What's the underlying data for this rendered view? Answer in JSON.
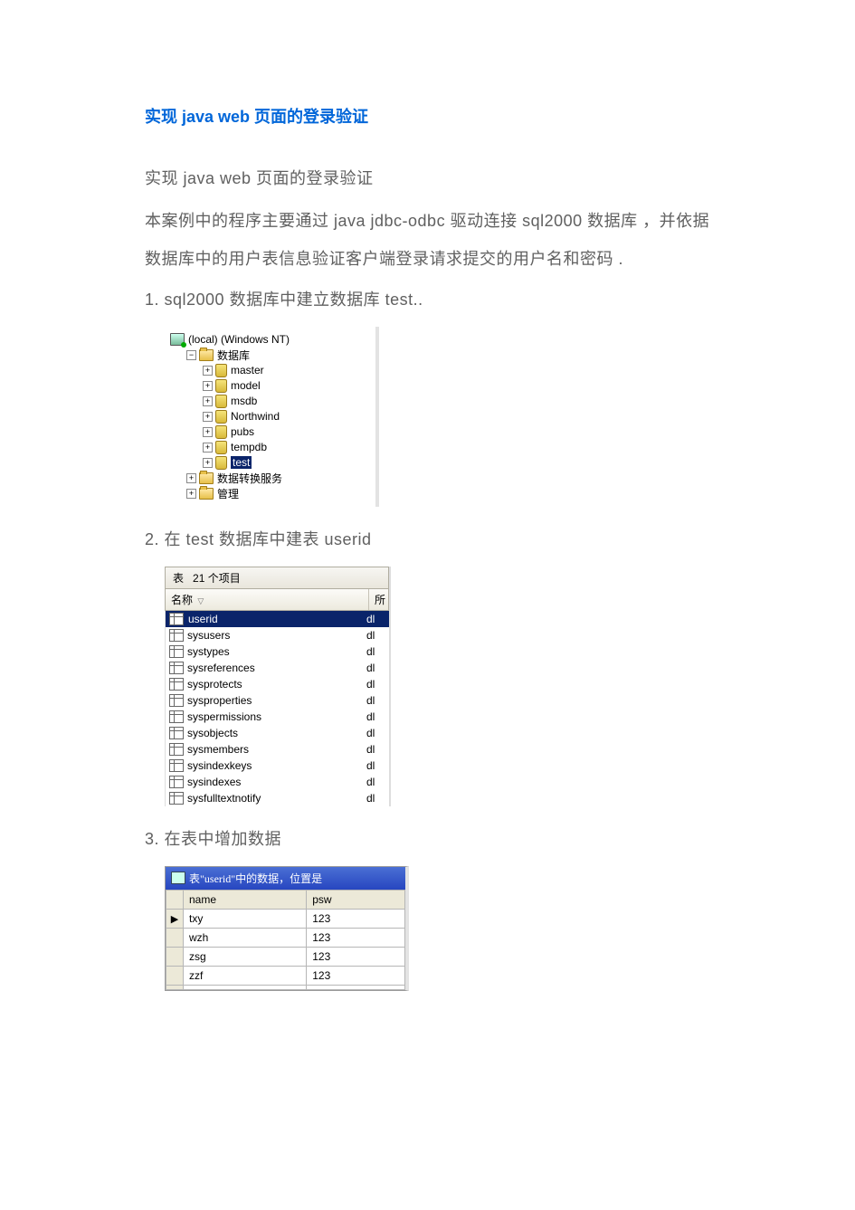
{
  "title": "实现 java web 页面的登录验证",
  "intro_1": "实现 java web 页面的登录验证",
  "intro_2": "本案例中的程序主要通过 java jdbc-odbc 驱动连接 sql2000 数据库 ，并依据数据库中的用户表信息验证客户端登录请求提交的用户名和密码 .",
  "step_1": "1. sql2000 数据库中建立数据库 test..",
  "step_2": "2. 在 test 数据库中建表 userid",
  "step_3": "3.  在表中增加数据",
  "tree": {
    "root": "(local) (Windows NT)",
    "folder_db": "数据库",
    "databases": [
      "master",
      "model",
      "msdb",
      "Northwind",
      "pubs",
      "tempdb"
    ],
    "selected_db": "test",
    "folder_dts": "数据转换服务",
    "folder_mgmt": "管理"
  },
  "tables": {
    "title_pre": "表",
    "title_count": "21 个项目",
    "col_name": "名称",
    "col_owner": "所",
    "rows": [
      {
        "name": "userid",
        "owner": "dl",
        "selected": true
      },
      {
        "name": "sysusers",
        "owner": "dl"
      },
      {
        "name": "systypes",
        "owner": "dl"
      },
      {
        "name": "sysreferences",
        "owner": "dl"
      },
      {
        "name": "sysprotects",
        "owner": "dl"
      },
      {
        "name": "sysproperties",
        "owner": "dl"
      },
      {
        "name": "syspermissions",
        "owner": "dl"
      },
      {
        "name": "sysobjects",
        "owner": "dl"
      },
      {
        "name": "sysmembers",
        "owner": "dl"
      },
      {
        "name": "sysindexkeys",
        "owner": "dl"
      },
      {
        "name": "sysindexes",
        "owner": "dl"
      },
      {
        "name": "sysfulltextnotify",
        "owner": "dl"
      }
    ]
  },
  "grid": {
    "window_title": "表\"userid\"中的数据，位置是",
    "col_name": "name",
    "col_psw": "psw",
    "rows": [
      {
        "name": "txy",
        "psw": "123",
        "cursor": true
      },
      {
        "name": "wzh",
        "psw": "123"
      },
      {
        "name": "zsg",
        "psw": "123"
      },
      {
        "name": "zzf",
        "psw": "123"
      }
    ]
  }
}
